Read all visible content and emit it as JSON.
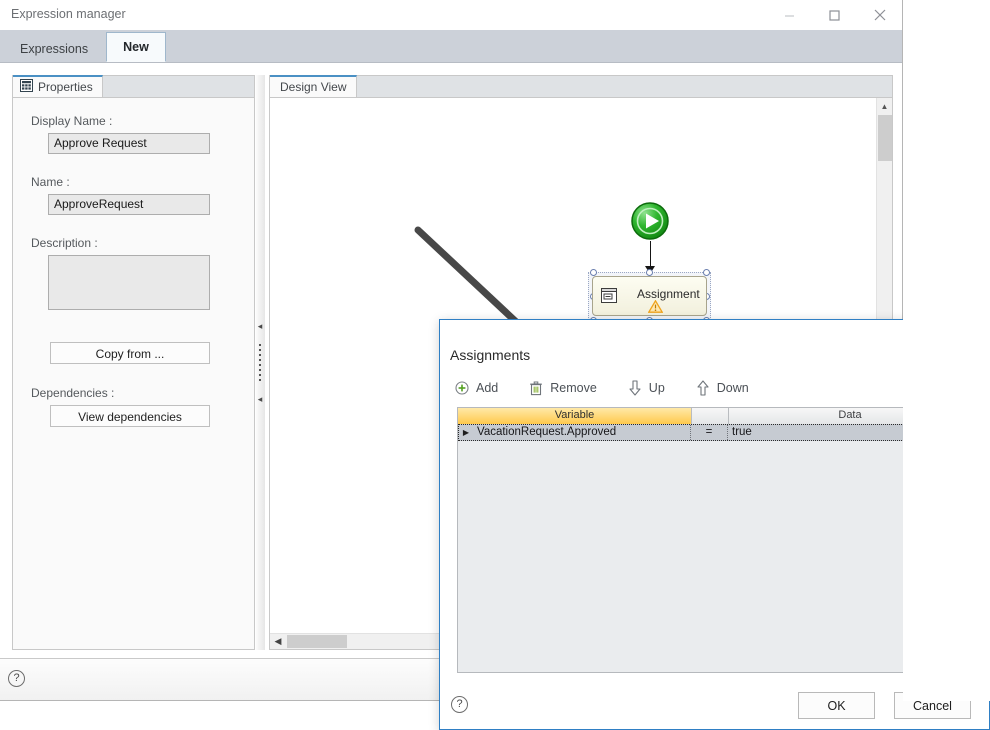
{
  "window": {
    "title": "Expression manager",
    "controls": [
      {
        "name": "minimize",
        "glyph": "—"
      },
      {
        "name": "maximize",
        "glyph": "□"
      },
      {
        "name": "close",
        "glyph": "×"
      }
    ],
    "tabs": [
      {
        "label": "Expressions",
        "active": false
      },
      {
        "label": "New",
        "active": true
      }
    ],
    "help_glyph": "?"
  },
  "properties": {
    "tab_label": "Properties",
    "tab_icon": "properties-grid-icon",
    "fields": [
      {
        "label": "Display Name :",
        "value": "Approve Request"
      },
      {
        "label": "Name :",
        "value": "ApproveRequest"
      },
      {
        "label": "Description :",
        "value": ""
      }
    ],
    "display_name_label": "Display Name :",
    "display_name_value": "Approve Request",
    "name_label": "Name :",
    "name_value": "ApproveRequest",
    "description_label": "Description :",
    "description_value": "",
    "copy_from_label": "Copy from ...",
    "dependencies_label": "Dependencies :",
    "view_dependencies_label": "View dependencies"
  },
  "design_view": {
    "tab_label": "Design View",
    "nodes": [
      {
        "type": "start",
        "label": "",
        "icon": "play-start-icon"
      },
      {
        "type": "activity",
        "label": "Assignment",
        "icon": "assignment-icon",
        "warning": true,
        "selected": true
      },
      {
        "type": "end",
        "label": "",
        "icon": "stop-end-icon"
      }
    ],
    "assignment_label": "Assignment"
  },
  "dialog": {
    "title": "Assignments",
    "close_glyph": "✕",
    "toolbar": [
      {
        "label": "Add",
        "icon": "add-circle-icon"
      },
      {
        "label": "Remove",
        "icon": "trash-icon"
      },
      {
        "label": "Up",
        "icon": "arrow-down-outline-icon"
      },
      {
        "label": "Down",
        "icon": "arrow-up-outline-icon"
      }
    ],
    "grid": {
      "columns": [
        "Variable",
        "",
        "Data"
      ],
      "sorted_column": "Variable",
      "rows": [
        {
          "selected": true,
          "variable": "VacationRequest.Approved",
          "operator": "=",
          "data": "true"
        }
      ]
    },
    "help_glyph": "?",
    "ok_label": "OK",
    "cancel_label": "Cancel"
  },
  "colors": {
    "accent": "#2f7fc4",
    "tabstrip": "#ccd1d9",
    "sorted_header": "#ffc94d",
    "row_selected": "#c6cbd2",
    "start_node": "#22a322",
    "end_node": "#d72020",
    "warning": "#f5a623",
    "annotation_arrow": "#484848"
  }
}
